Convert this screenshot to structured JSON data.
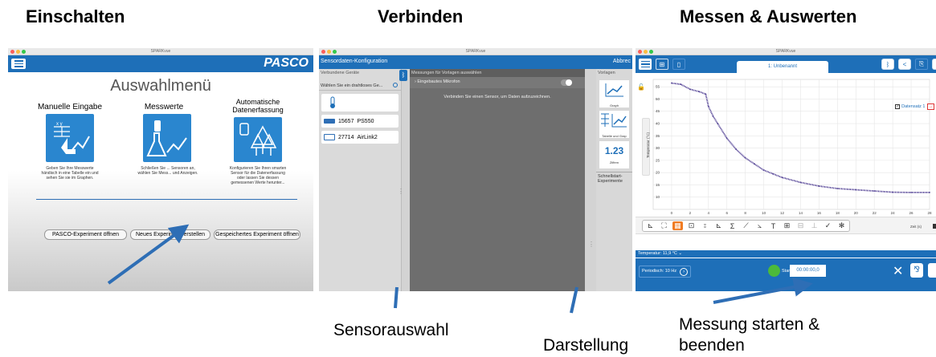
{
  "headings": {
    "power_on": "Einschalten",
    "connect": "Verbinden",
    "measure": "Messen & Auswerten"
  },
  "captions": {
    "sensor_select": "Sensorauswahl",
    "display": "Darstellung",
    "start_stop": "Messung starten &",
    "start_stop_2": "beenden"
  },
  "app_title": "SPARKvue",
  "colors": {
    "brand_blue": "#1e6fb8",
    "tile_blue": "#2a86cf",
    "arrow_blue": "#2e6eb5",
    "plot_purple": "#5b4b9a",
    "start_green": "#4cba3a"
  },
  "screen1": {
    "logo": "PASCO",
    "heading": "Auswahlmenü",
    "options": [
      {
        "title": "Manuelle Eingabe",
        "desc": "Geben Sie Ihre Messwerte händisch in eine Tabelle ein und sehen Sie sie im Graphen."
      },
      {
        "title": "Messwerte",
        "desc": "Schließen Sie ... Sensoren an, wählen Sie Mess... und Anzeigen."
      },
      {
        "title": "Automatische",
        "title2": "Datenerfassung",
        "desc": "Konfigurieren Sie Ihren smarten Sensor für die Datenerfassung oder lassen Sie dessen gemessenen Werte herunter..."
      }
    ],
    "buttons": {
      "open_pasco": "PASCO-Experiment öffnen",
      "new_experiment": "Neues Experiment erstellen",
      "open_saved": "Gespeichertes Experiment öffnen"
    }
  },
  "screen2": {
    "title": "Sensordaten-Konfiguration",
    "cancel": "Abbrec",
    "col_devices": "Verbundene Geräte",
    "col_measurements": "Messungen für Vorlagen auswählen",
    "col_templates": "Vorlagen",
    "wireless_prompt": "Wählen Sie ein drahtloses Ge...",
    "builtin_mic": "Eingebautes Mikrofon",
    "empty_hint": "Verbinden Sie einen Sensor, um Daten aufzuzeichnen.",
    "devices": [
      {
        "id": "15657",
        "name": "PS550"
      },
      {
        "id": "27714",
        "name": "AirLink2"
      }
    ],
    "templates": [
      "Graph",
      "Tabelle und Grap",
      "Ziffern"
    ],
    "digits_sample": "1.23",
    "quickstart": "Schnellstart-Experimente"
  },
  "screen3": {
    "tab": "1: Unbenannt",
    "y_axis_label": "Temperatur (°C)",
    "x_axis_label": "Zeit (s)",
    "legend": "Datensatz 1",
    "live_readout": "Temperatur: 11,9 °C",
    "period": "Periodisch: 10 Hz",
    "start": "Start",
    "timer": "00:00:00,0",
    "sigma": "Σ",
    "text_tool": "T"
  },
  "chart_data": {
    "type": "line",
    "ylabel": "Temperatur (°C)",
    "xlabel": "Zeit (s)",
    "xlim": [
      -2,
      28
    ],
    "ylim": [
      5,
      58
    ],
    "x_ticks": [
      0,
      2,
      4,
      6,
      8,
      10,
      12,
      14,
      16,
      18,
      20,
      22,
      24,
      26,
      28
    ],
    "y_ticks": [
      10,
      15,
      20,
      25,
      30,
      35,
      40,
      45,
      50,
      55
    ],
    "grid": true,
    "legend_position": "top-right",
    "series": [
      {
        "name": "Datensatz 1",
        "x": [
          0,
          1,
          2,
          3,
          3.7,
          4,
          4.5,
          5,
          6,
          7,
          8,
          9,
          10,
          11,
          12,
          14,
          16,
          18,
          20,
          22,
          24,
          26,
          28
        ],
        "y": [
          56.5,
          56,
          54,
          53,
          52,
          47,
          43,
          40,
          34,
          29.5,
          26,
          23.5,
          21,
          19.5,
          18,
          16,
          14.5,
          13.5,
          13,
          12.5,
          12,
          11.9,
          11.9
        ]
      }
    ]
  }
}
